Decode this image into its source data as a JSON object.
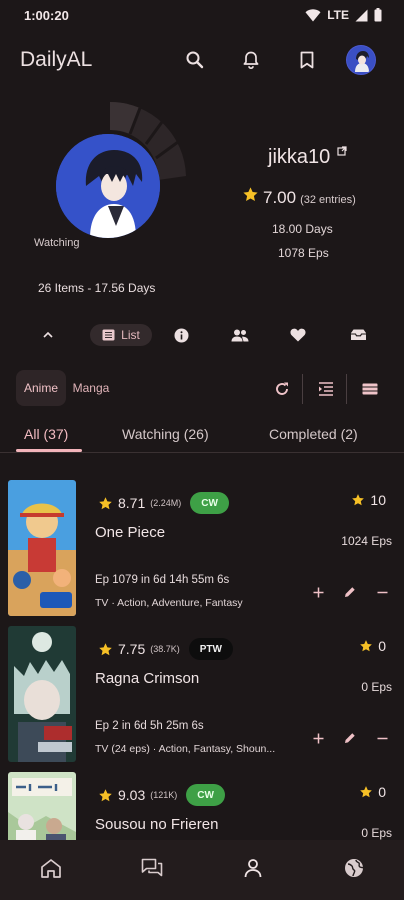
{
  "status_bar": {
    "time": "1:00:20",
    "network": "LTE"
  },
  "app_bar": {
    "title": "DailyAL"
  },
  "profile": {
    "username": "jikka10",
    "mean_score": "7.00",
    "entries": "(32 entries)",
    "days": "18.00 Days",
    "episodes": "1078 Eps",
    "avatar_label": "Watching",
    "items_days": "26 Items - 17.56 Days"
  },
  "section_tabs": {
    "list_label": "List"
  },
  "media_toggle": {
    "anime": "Anime",
    "manga": "Manga"
  },
  "filter_tabs": [
    "All (37)",
    "Watching (26)",
    "Completed (2)"
  ],
  "entries": [
    {
      "score": "8.71",
      "popularity": "(2.24M)",
      "status": "CW",
      "title": "One Piece",
      "next_episode": "Ep 1079 in 6d 14h 55m 6s",
      "genres": "TV  · Action, Adventure, Fantasy",
      "user_score": "10",
      "user_eps": "1024 Eps"
    },
    {
      "score": "7.75",
      "popularity": "(38.7K)",
      "status": "PTW",
      "title": "Ragna Crimson",
      "next_episode": "Ep 2 in 6d 5h 25m 6s",
      "genres": "TV (24 eps) · Action, Fantasy, Shoun...",
      "user_score": "0",
      "user_eps": "0 Eps"
    },
    {
      "score": "9.03",
      "popularity": "(121K)",
      "status": "CW",
      "title": "Sousou no Frieren",
      "user_score": "0",
      "user_eps": "0 Eps"
    }
  ],
  "colors": {
    "background": "#1c1718",
    "accent": "#f3b5bb",
    "star": "#f6c026",
    "cw_badge": "#3ea046",
    "ptw_badge": "#0d0d0d"
  }
}
